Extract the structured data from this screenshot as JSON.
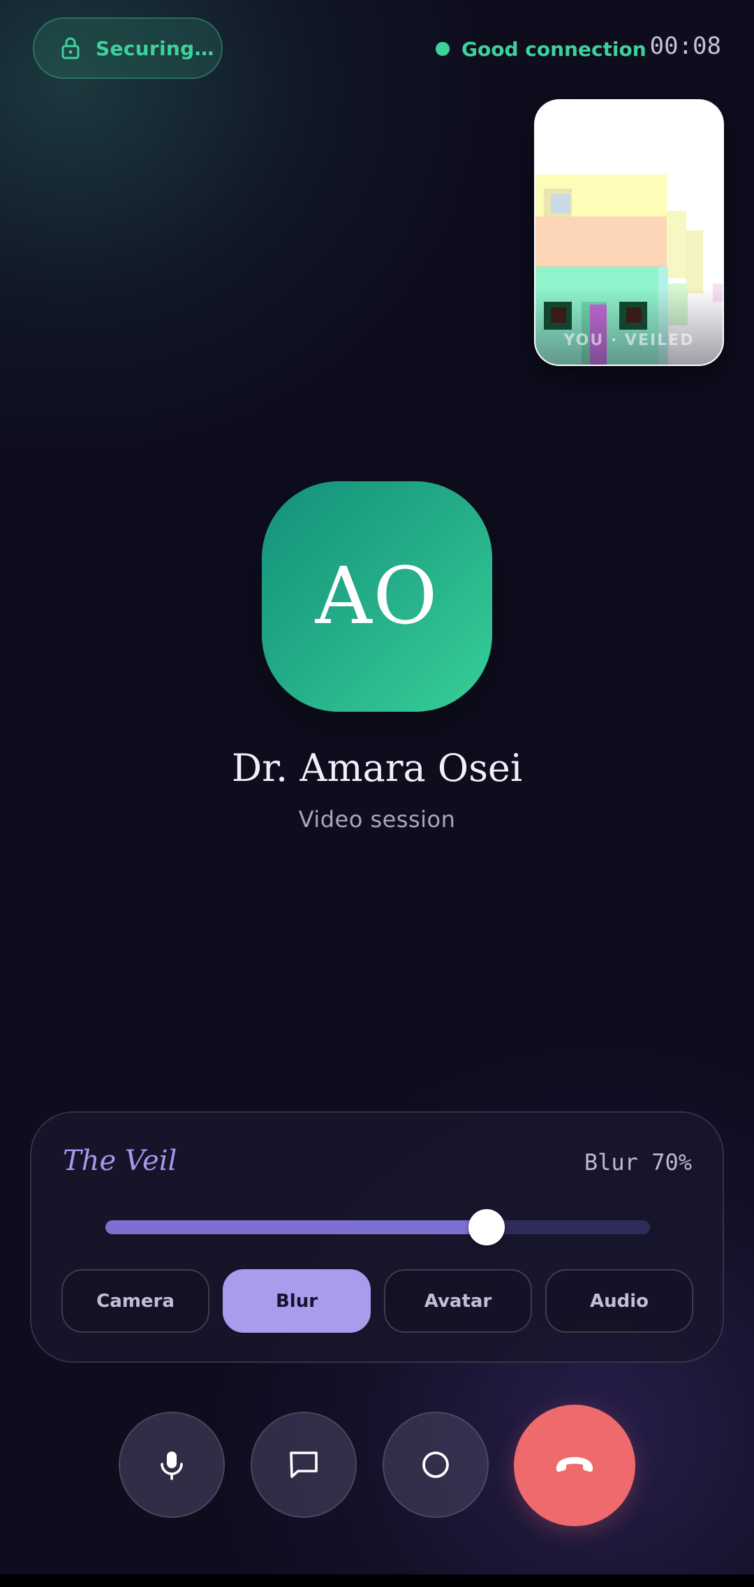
{
  "status": {
    "secure_label": "Securing…",
    "connection_label": "Good connection",
    "connection_color": "#3fd19c",
    "timer": "00:08"
  },
  "self_view": {
    "label": "YOU · VEILED"
  },
  "caller": {
    "initials": "AO",
    "name": "Dr. Amara Osei",
    "session_type": "Video session"
  },
  "veil": {
    "title": "The Veil",
    "level_label": "Blur 70%",
    "level": 0.7,
    "modes": [
      {
        "label": "Camera",
        "active": false
      },
      {
        "label": "Blur",
        "active": true
      },
      {
        "label": "Avatar",
        "active": false
      },
      {
        "label": "Audio",
        "active": false
      }
    ]
  },
  "controls": {
    "icons": [
      "microphone-icon",
      "chat-icon",
      "record-icon",
      "end-call-icon"
    ],
    "end_call_color": "#ee6a6c"
  }
}
